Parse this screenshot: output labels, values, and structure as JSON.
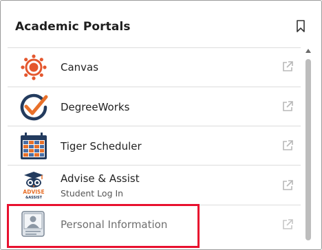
{
  "widget": {
    "title": "Academic Portals",
    "bookmark_icon": "bookmark-icon"
  },
  "portals": [
    {
      "label": "Canvas",
      "sublabel": "",
      "icon": "canvas-logo"
    },
    {
      "label": "DegreeWorks",
      "sublabel": "",
      "icon": "degreeworks-logo"
    },
    {
      "label": "Tiger Scheduler",
      "sublabel": "",
      "icon": "tiger-scheduler-logo"
    },
    {
      "label": "Advise & Assist",
      "sublabel": "Student Log In",
      "icon": "advise-assist-logo"
    },
    {
      "label": "Personal Information",
      "sublabel": "",
      "icon": "personal-info-icon"
    }
  ],
  "logo_text": {
    "advise": "ADVISE",
    "assist": "&ASSIST"
  },
  "colors": {
    "canvas": "#e4572e",
    "degreeworks_ring": "#233b5e",
    "degreeworks_check": "#e8702a",
    "highlight_border": "#e8102e",
    "external_icon": "#b8b8b8"
  }
}
